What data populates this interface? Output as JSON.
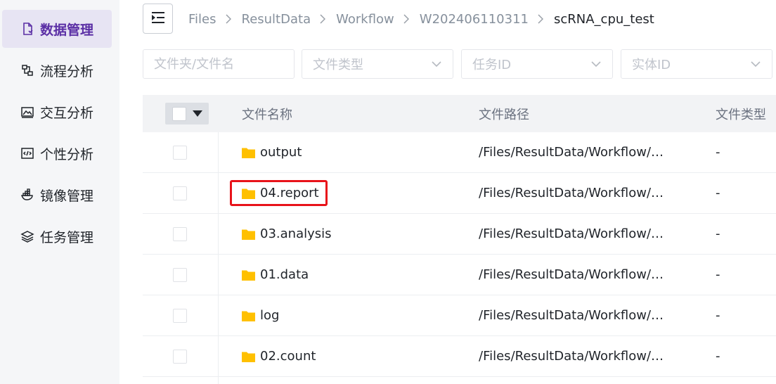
{
  "sidebar": {
    "items": [
      {
        "label": "数据管理",
        "icon": "file-icon",
        "active": true
      },
      {
        "label": "流程分析",
        "icon": "flow-icon"
      },
      {
        "label": "交互分析",
        "icon": "image-chart-icon"
      },
      {
        "label": "个性分析",
        "icon": "code-icon"
      },
      {
        "label": "镜像管理",
        "icon": "docker-icon"
      },
      {
        "label": "任务管理",
        "icon": "layers-icon"
      }
    ]
  },
  "breadcrumb": [
    "Files",
    "ResultData",
    "Workflow",
    "W202406110311",
    "scRNA_cpu_test"
  ],
  "filters": {
    "name_placeholder": "文件夹/文件名",
    "type_placeholder": "文件类型",
    "task_placeholder": "任务ID",
    "entity_placeholder": "实体ID"
  },
  "table": {
    "headers": {
      "name": "文件名称",
      "path": "文件路径",
      "type": "文件类型"
    },
    "rows": [
      {
        "name": "output",
        "path": "/Files/ResultData/Workflow/…",
        "type": "-"
      },
      {
        "name": "04.report",
        "path": "/Files/ResultData/Workflow/…",
        "type": "-"
      },
      {
        "name": "03.analysis",
        "path": "/Files/ResultData/Workflow/…",
        "type": "-"
      },
      {
        "name": "01.data",
        "path": "/Files/ResultData/Workflow/…",
        "type": "-"
      },
      {
        "name": "log",
        "path": "/Files/ResultData/Workflow/…",
        "type": "-"
      },
      {
        "name": "02.count",
        "path": "/Files/ResultData/Workflow/…",
        "type": "-"
      }
    ]
  },
  "colors": {
    "accent": "#5b2fa5",
    "folder": "#ffc000",
    "highlight": "#e8131a"
  }
}
